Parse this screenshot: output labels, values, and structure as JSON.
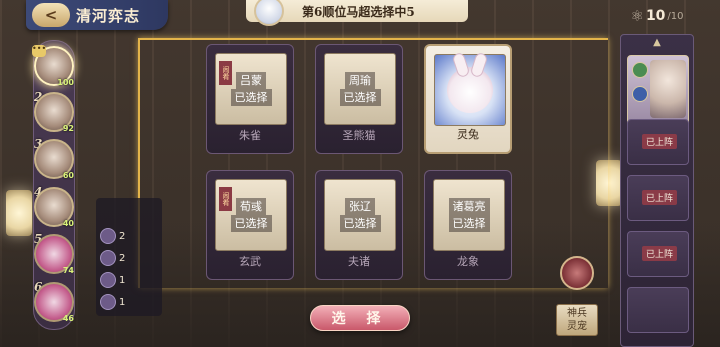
{
  "header": {
    "back_label": "<",
    "title": "清河弈志",
    "banner_text": "第6顺位马超选择中5",
    "counter_value": "10",
    "counter_total": "/10"
  },
  "heroes": [
    {
      "num": "1",
      "level": "100"
    },
    {
      "num": "2",
      "level": "92"
    },
    {
      "num": "3",
      "level": "60"
    },
    {
      "num": "4",
      "level": "40"
    },
    {
      "num": "5",
      "level": "74"
    },
    {
      "num": "6",
      "level": "46"
    }
  ],
  "cards": [
    {
      "name": "朱雀",
      "hero": "吕蒙",
      "status": "已选择",
      "tag": "闹肴"
    },
    {
      "name": "圣熊猫",
      "hero": "周瑜",
      "status": "已选择",
      "tag": ""
    },
    {
      "name": "灵兔",
      "hero": "",
      "status": "",
      "tag": ""
    },
    {
      "name": "玄武",
      "hero": "荀彧",
      "status": "已选择",
      "tag": "闹肴"
    },
    {
      "name": "夫诸",
      "hero": "张辽",
      "status": "已选择",
      "tag": ""
    },
    {
      "name": "龙象",
      "hero": "诸葛亮",
      "status": "已选择",
      "tag": ""
    }
  ],
  "stats": [
    {
      "num": "2",
      "label": "2"
    },
    {
      "num": "2",
      "label": "2"
    },
    {
      "num": "1",
      "label": "1"
    },
    {
      "num": "1",
      "label": "1"
    }
  ],
  "select_button": "选 择",
  "right_panel": {
    "slots": [
      {
        "badge": "已上阵"
      },
      {
        "badge": "已上阵"
      },
      {
        "badge": "已上阵"
      }
    ]
  },
  "shenbing_button": {
    "line1": "神兵",
    "line2": "灵宠"
  },
  "colors": {
    "gold": "#e3b44a",
    "title_bg": "#3d4a78",
    "select_btn": "#c9586a"
  }
}
